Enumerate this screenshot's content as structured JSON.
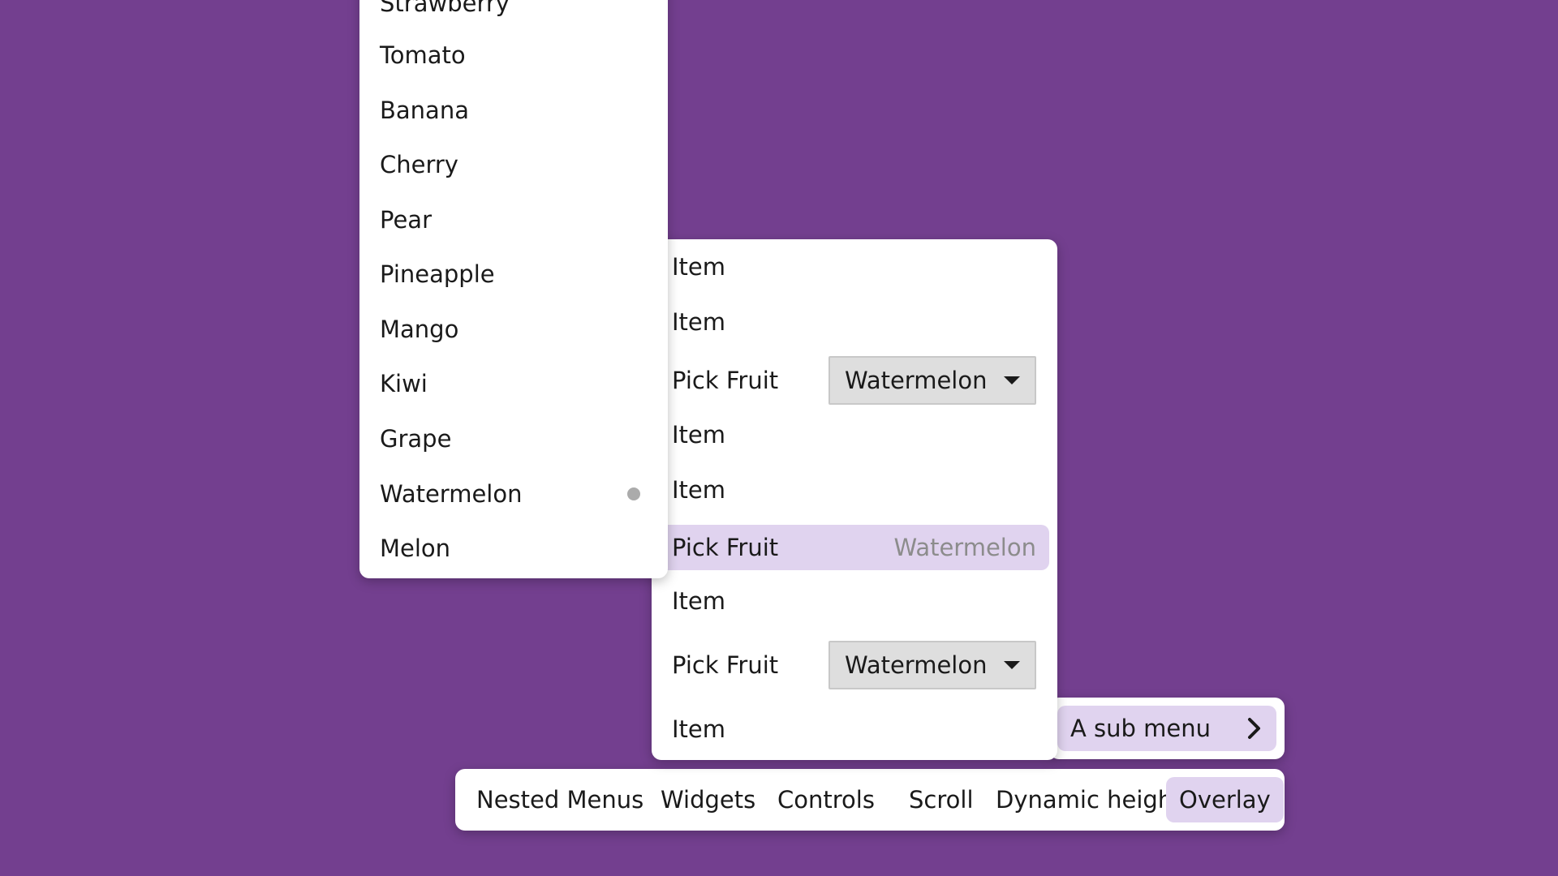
{
  "fruit_list": {
    "items": [
      "Strawberry",
      "Tomato",
      "Banana",
      "Cherry",
      "Pear",
      "Pineapple",
      "Mango",
      "Kiwi",
      "Grape",
      "Watermelon",
      "Melon"
    ],
    "selected": "Watermelon"
  },
  "menu": {
    "rows": [
      {
        "label": "Item"
      },
      {
        "label": "Item"
      },
      {
        "label": "Pick Fruit",
        "combo_value": "Watermelon"
      },
      {
        "label": "Item"
      },
      {
        "label": "Item"
      },
      {
        "label": "Pick Fruit",
        "value": "Watermelon"
      },
      {
        "label": "Item"
      },
      {
        "label": "Pick Fruit",
        "combo_value": "Watermelon"
      },
      {
        "label": "Item"
      }
    ]
  },
  "submenu": {
    "label": "A sub menu",
    "icon": "chevron-right-icon"
  },
  "menubar": {
    "items": [
      "Nested Menus",
      "Widgets",
      "Controls",
      "Scroll",
      "Dynamic height",
      "Overlay"
    ],
    "active": "Overlay"
  },
  "colors": {
    "background": "#733f8f",
    "highlight": "#e0d3ef",
    "combo": "#dedede"
  }
}
